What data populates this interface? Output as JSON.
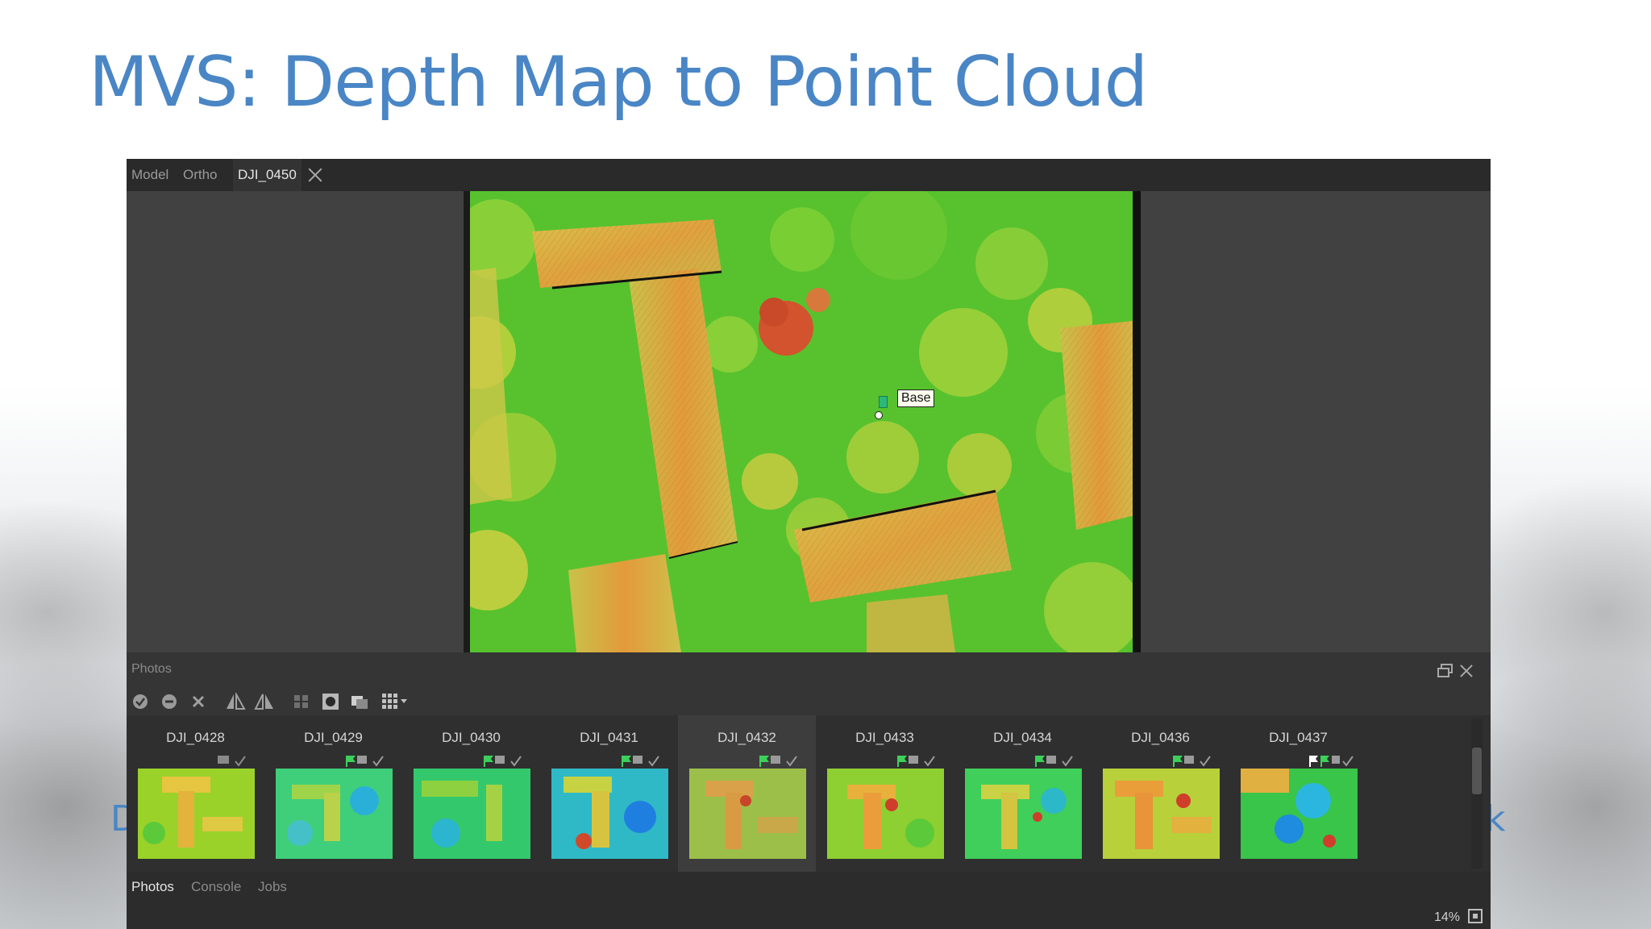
{
  "slide": {
    "title": "MVS: Depth Map to Point Cloud",
    "fragment_left": "D",
    "fragment_right": "k"
  },
  "app": {
    "tabs": [
      {
        "label": "Model",
        "active": false
      },
      {
        "label": "Ortho",
        "active": false
      },
      {
        "label": "DJI_0450",
        "active": true,
        "closable": true
      }
    ],
    "viewport": {
      "label": "Base"
    },
    "photos_panel": {
      "title": "Photos",
      "toolbar_icons": [
        "check-circle-icon",
        "minus-circle-icon",
        "x-icon",
        "flip-horizontal-icon",
        "flip-vertical-icon",
        "group-icon",
        "mask-icon",
        "overlay-icon",
        "grid-view-icon"
      ],
      "thumbnails": [
        {
          "name": "DJI_0428",
          "style": "yellow",
          "flags": [
            "camera-icon",
            "check-icon"
          ]
        },
        {
          "name": "DJI_0429",
          "style": "cyan",
          "flags": [
            "flag-icon",
            "camera-icon",
            "check-icon"
          ]
        },
        {
          "name": "DJI_0430",
          "style": "cyan",
          "flags": [
            "flag-icon",
            "camera-icon",
            "check-icon"
          ]
        },
        {
          "name": "DJI_0431",
          "style": "blue",
          "flags": [
            "flag-icon",
            "camera-icon",
            "check-icon"
          ]
        },
        {
          "name": "DJI_0432",
          "style": "olive",
          "flags": [
            "flag-icon",
            "camera-icon",
            "check-icon"
          ],
          "selected": true
        },
        {
          "name": "DJI_0433",
          "style": "yellow",
          "flags": [
            "flag-icon",
            "camera-icon",
            "check-icon"
          ]
        },
        {
          "name": "DJI_0434",
          "style": "cyan",
          "flags": [
            "flag-icon",
            "camera-icon",
            "check-icon"
          ]
        },
        {
          "name": "DJI_0436",
          "style": "orange",
          "flags": [
            "flag-icon",
            "camera-icon",
            "check-icon"
          ]
        },
        {
          "name": "DJI_0437",
          "style": "blue",
          "flags": [
            "white-flag-icon",
            "flag-icon",
            "camera-icon",
            "check-icon"
          ]
        }
      ]
    },
    "bottom_tabs": [
      {
        "label": "Photos",
        "active": true
      },
      {
        "label": "Console",
        "active": false
      },
      {
        "label": "Jobs",
        "active": false
      }
    ],
    "status": {
      "zoom": "14%"
    }
  }
}
